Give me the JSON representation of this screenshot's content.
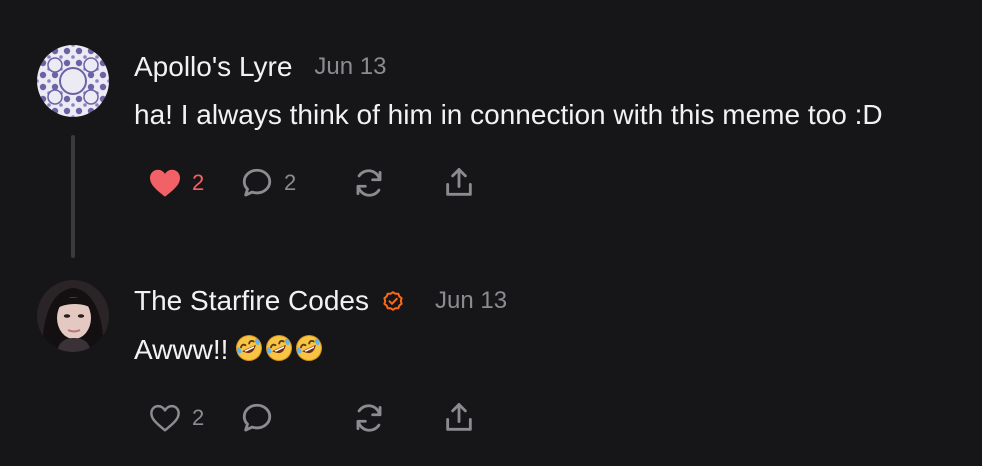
{
  "comments": [
    {
      "author": "Apollo's Lyre",
      "date": "Jun 13",
      "text": "ha! I always think of him in connection with this meme too :D",
      "likes": "2",
      "liked": true,
      "replies": "2",
      "verified": false,
      "avatar": "pattern-avatar"
    },
    {
      "author": "The Starfire Codes",
      "date": "Jun 13",
      "text": "Awww!!",
      "emojis": [
        "rolling-on-floor-laughing",
        "rolling-on-floor-laughing",
        "rolling-on-floor-laughing"
      ],
      "likes": "2",
      "liked": false,
      "replies": "",
      "verified": true,
      "avatar": "photo-avatar"
    }
  ],
  "icons": {
    "like": "heart-icon",
    "reply": "comment-bubble-icon",
    "restack": "restack-icon",
    "share": "share-icon",
    "verified": "verified-badge-icon"
  },
  "colors": {
    "background": "#161618",
    "text": "#f2f2f2",
    "muted": "#8c8c90",
    "like": "#f26165",
    "verified": "#ff6719",
    "thread_line": "#3a3a3d"
  }
}
